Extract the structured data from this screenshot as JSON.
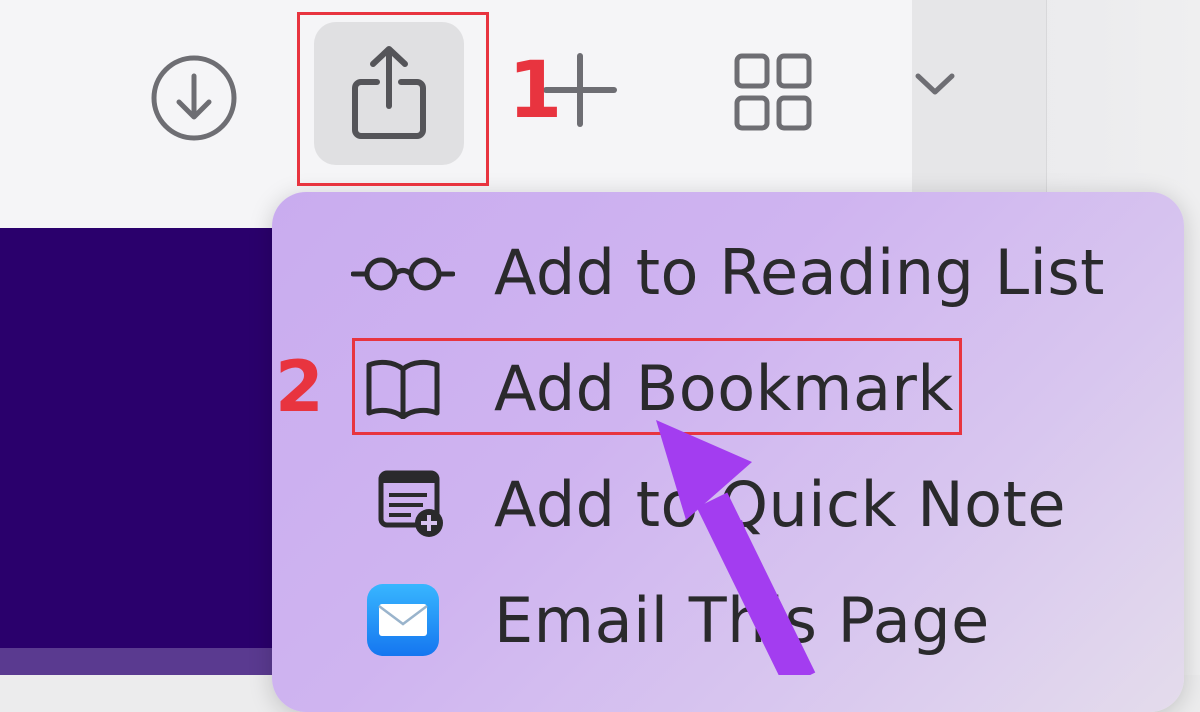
{
  "toolbar": {
    "download_icon": "download-circle-icon",
    "share_icon": "share-icon",
    "new_tab_icon": "plus-icon",
    "tab_overview_icon": "grid-icon",
    "more_icon": "chevron-down-icon"
  },
  "annotations": {
    "step1": "1",
    "step2": "2",
    "highlight_color": "#e8343f",
    "arrow_color": "#a33df0"
  },
  "share_menu": {
    "items": [
      {
        "label": "Add to Reading List",
        "icon": "glasses-icon"
      },
      {
        "label": "Add Bookmark",
        "icon": "book-icon"
      },
      {
        "label": "Add to Quick Note",
        "icon": "quick-note-icon"
      },
      {
        "label": "Email This Page",
        "icon": "mail-icon"
      }
    ]
  },
  "colors": {
    "page_background": "#2a006c",
    "menu_background": "#cfb4f0"
  }
}
